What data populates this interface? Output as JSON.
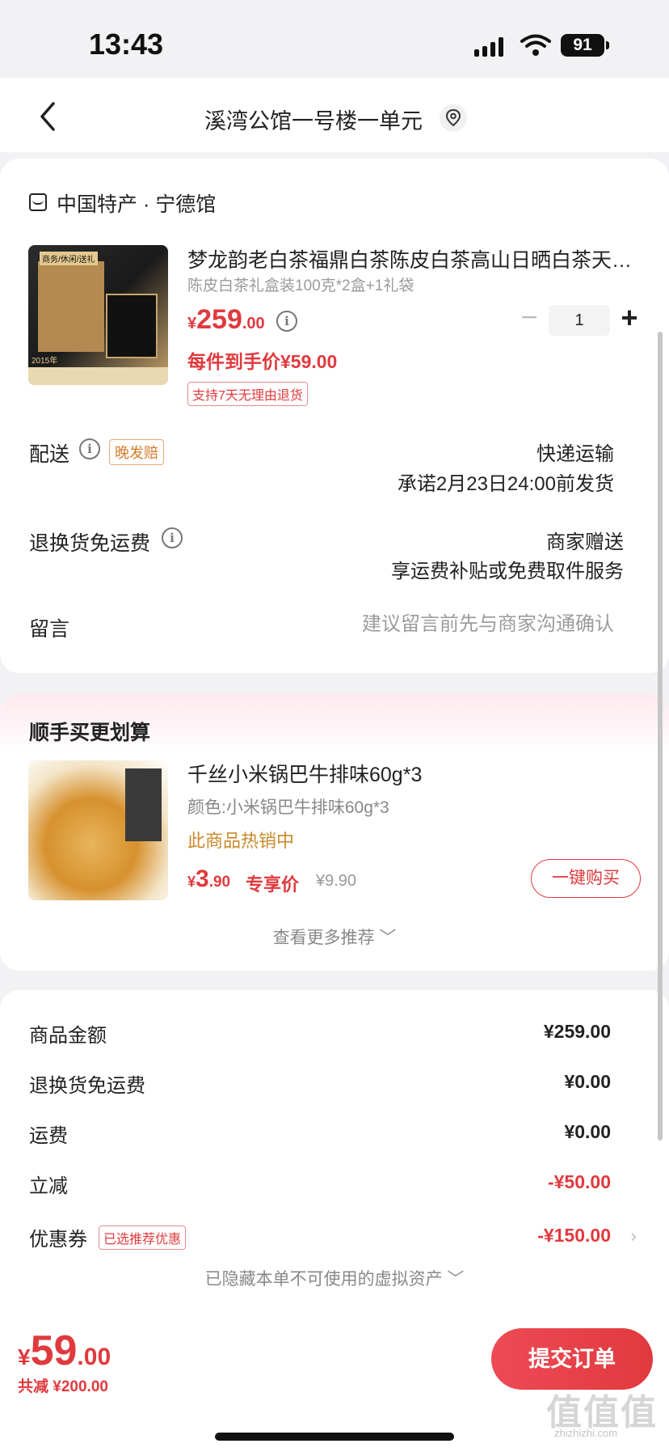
{
  "status_bar": {
    "time": "13:43",
    "battery": "91"
  },
  "header": {
    "title": "溪湾公馆一号楼一单元"
  },
  "shop": {
    "name": "中国特产 · 宁德馆"
  },
  "product": {
    "title": "梦龙韵老白茶福鼎白茶陈皮白茶高山日晒白茶天…",
    "spec": "陈皮白茶礼盒装100克*2盒+1礼袋",
    "price_symbol": "¥",
    "price_int": "259",
    "price_dec": ".00",
    "unit_price": "每件到手价¥59.00",
    "return_policy": "支持7天无理由退货",
    "quantity": "1",
    "qty_minus": "−",
    "qty_plus": "+",
    "image_labels": {
      "tag": "商务/休闲/送礼",
      "year": "2015年"
    }
  },
  "delivery": {
    "label": "配送",
    "badge": "晚发赔",
    "method": "快递运输",
    "promise": "承诺2月23日24:00前发货"
  },
  "return_shipping": {
    "label": "退换货免运费",
    "giver": "商家赠送",
    "service": "享运费补贴或免费取件服务"
  },
  "message": {
    "label": "留言",
    "placeholder": "建议留言前先与商家沟通确认"
  },
  "recommend": {
    "title": "顺手买更划算",
    "item": {
      "name": "千丝小米锅巴牛排味60g*3",
      "color": "颜色:小米锅巴牛排味60g*3",
      "hot": "此商品热销中",
      "price_symbol": "¥",
      "price_int": "3",
      "price_dec": ".90",
      "exclusive": "专享价",
      "original_price": "¥9.90",
      "buy_label": "一键购买"
    },
    "more": "查看更多推荐 ﹀"
  },
  "summary": {
    "goods_amount": {
      "label": "商品金额",
      "value": "¥259.00"
    },
    "return_fee": {
      "label": "退换货免运费",
      "value": "¥0.00"
    },
    "shipping": {
      "label": "运费",
      "value": "¥0.00"
    },
    "discount": {
      "label": "立减",
      "value": "-¥50.00"
    },
    "coupon": {
      "label": "优惠券",
      "badge": "已选推荐优惠",
      "value": "-¥150.00"
    },
    "hidden_assets": "已隐藏本单不可使用的虚拟资产 ﹀"
  },
  "bottom": {
    "price_symbol": "¥",
    "price_int": "59",
    "price_dec": ".00",
    "saved": "共减 ¥200.00",
    "submit": "提交订单"
  },
  "watermark": {
    "main": "值值值",
    "sub": "zhizhizhi.com"
  },
  "colors": {
    "accent": "#e03a3e",
    "badge_orange": "#d67c2a",
    "background": "#f2f2f4"
  }
}
